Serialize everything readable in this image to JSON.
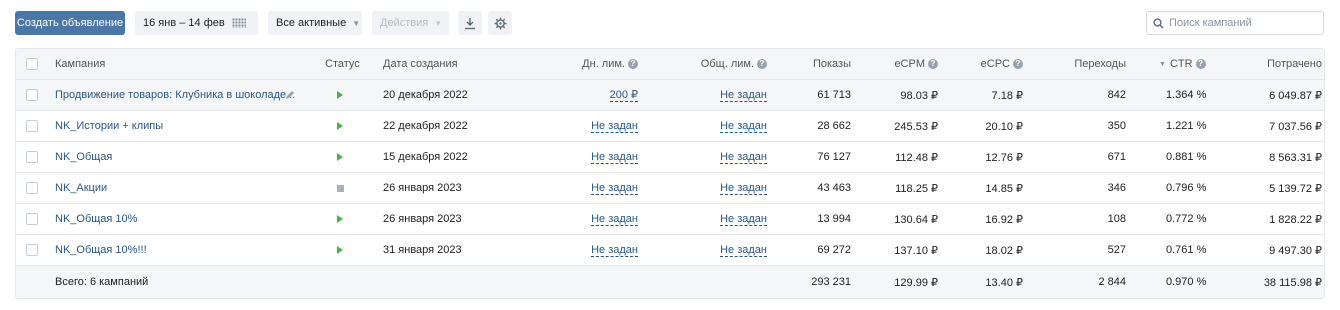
{
  "toolbar": {
    "create_label": "Создать объявление",
    "date_range": "16 янв – 14 фев",
    "filter_label": "Все активные",
    "actions_label": "Действия",
    "search_placeholder": "Поиск кампаний"
  },
  "icons": {
    "calendar": "calendar-icon",
    "download": "download-icon",
    "settings": "gear-icon",
    "search": "search-icon",
    "edit": "pencil-icon",
    "help": "question-icon",
    "status_active": "play-icon",
    "status_stopped": "stop-icon"
  },
  "colors": {
    "accent": "#4a76a8",
    "link": "#2a5885",
    "active": "#4bb34b",
    "stopped": "#a8b0b9"
  },
  "table": {
    "headers": {
      "campaign": "Кампания",
      "status": "Статус",
      "created": "Дата создания",
      "daily_limit": "Дн. лим.",
      "total_limit": "Общ. лим.",
      "impressions": "Показы",
      "ecpm": "eCPM",
      "ecpc": "eCPC",
      "clicks": "Переходы",
      "ctr": "CTR",
      "spent": "Потрачено"
    },
    "rows": [
      {
        "name": "Продвижение товаров: Клубника в шоколаде...",
        "status": "active",
        "created": "20 декабря 2022",
        "daily_limit": "200 ₽",
        "total_limit": "Не задан",
        "impressions": "61 713",
        "ecpm": "98.03 ₽",
        "ecpc": "7.18 ₽",
        "clicks": "842",
        "ctr": "1.364 %",
        "spent": "6 049.87 ₽"
      },
      {
        "name": "NK_Истории + клипы",
        "status": "active",
        "created": "22 декабря 2022",
        "daily_limit": "Не задан",
        "total_limit": "Не задан",
        "impressions": "28 662",
        "ecpm": "245.53 ₽",
        "ecpc": "20.10 ₽",
        "clicks": "350",
        "ctr": "1.221 %",
        "spent": "7 037.56 ₽"
      },
      {
        "name": "NK_Общая",
        "status": "active",
        "created": "15 декабря 2022",
        "daily_limit": "Не задан",
        "total_limit": "Не задан",
        "impressions": "76 127",
        "ecpm": "112.48 ₽",
        "ecpc": "12.76 ₽",
        "clicks": "671",
        "ctr": "0.881 %",
        "spent": "8 563.31 ₽"
      },
      {
        "name": "NK_Акции",
        "status": "stopped",
        "created": "26 января 2023",
        "daily_limit": "Не задан",
        "total_limit": "Не задан",
        "impressions": "43 463",
        "ecpm": "118.25 ₽",
        "ecpc": "14.85 ₽",
        "clicks": "346",
        "ctr": "0.796 %",
        "spent": "5 139.72 ₽"
      },
      {
        "name": "NK_Общая 10%",
        "status": "active",
        "created": "26 января 2023",
        "daily_limit": "Не задан",
        "total_limit": "Не задан",
        "impressions": "13 994",
        "ecpm": "130.64 ₽",
        "ecpc": "16.92 ₽",
        "clicks": "108",
        "ctr": "0.772 %",
        "spent": "1 828.22 ₽"
      },
      {
        "name": "NK_Общая 10%!!!",
        "status": "active",
        "created": "31 января 2023",
        "daily_limit": "Не задан",
        "total_limit": "Не задан",
        "impressions": "69 272",
        "ecpm": "137.10 ₽",
        "ecpc": "18.02 ₽",
        "clicks": "527",
        "ctr": "0.761 %",
        "spent": "9 497.30 ₽"
      }
    ],
    "total": {
      "label": "Всего: 6 кампаний",
      "impressions": "293 231",
      "ecpm": "129.99 ₽",
      "ecpc": "13.40 ₽",
      "clicks": "2 844",
      "ctr": "0.970 %",
      "spent": "38 115.98 ₽"
    }
  }
}
